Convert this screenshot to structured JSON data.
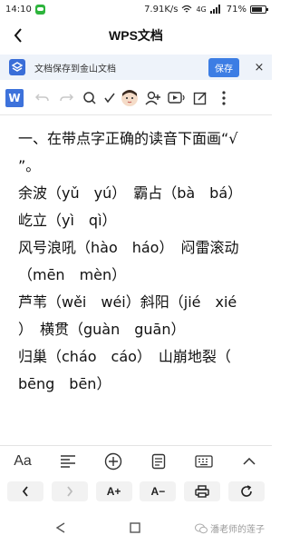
{
  "status": {
    "time": "14:10",
    "speed": "7.91K/s",
    "network": "4G",
    "battery": "71%",
    "battery_level": 0.71
  },
  "header": {
    "title": "WPS文档"
  },
  "banner": {
    "text": "文档保存到金山文档",
    "save_label": "保存",
    "close_label": "×"
  },
  "toolbar": {
    "logo": "W"
  },
  "document": {
    "lines": [
      "一、在带点字正确的读音下面画“√",
      "”。",
      "余波（yǔ　yú）　霸占（bà　bá）",
      "屹立（yì　qì）",
      "风号浪吼（hào　háo）　闷雷滚动",
      "（mēn　mèn）",
      "芦苇（wěi　wéi）斜阳（jié　xié",
      "）　横贯（guàn　guān）",
      "归巢（cháo　cáo）　山崩地裂（",
      "bēng　bēn）"
    ]
  },
  "editbar": {
    "font_label": "Aa"
  },
  "readbar": {
    "font_up": "A+",
    "font_down": "A−"
  },
  "watermark": {
    "text": "潘老师的莲子"
  },
  "colors": {
    "accent": "#3c7de4",
    "banner_bg": "#eef3fa",
    "wechat_green": "#2db43c"
  }
}
